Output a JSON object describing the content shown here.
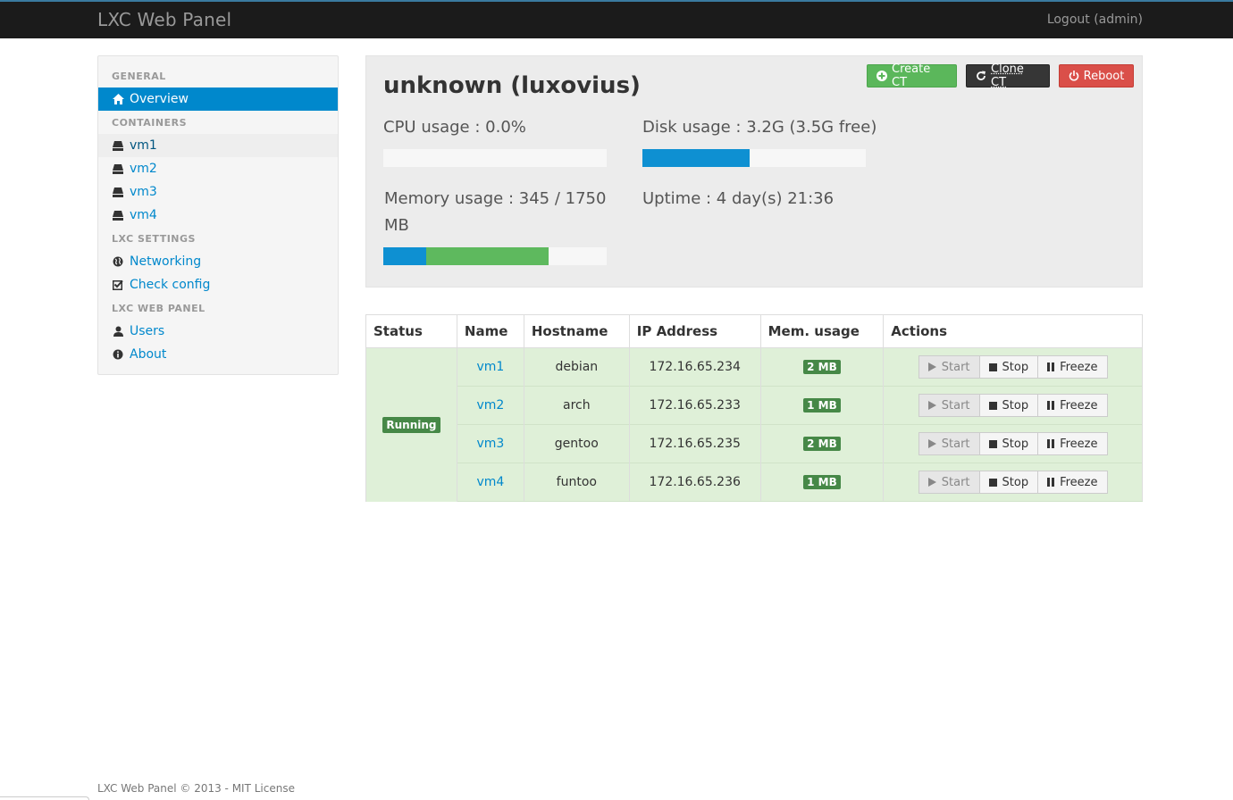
{
  "navbar": {
    "brand": "LXC Web Panel",
    "logout": "Logout (admin)"
  },
  "sidebar": {
    "headers": [
      "GENERAL",
      "CONTAINERS",
      "LXC SETTINGS",
      "LXC WEB PANEL"
    ],
    "overview": "Overview",
    "containers": [
      "vm1",
      "vm2",
      "vm3",
      "vm4"
    ],
    "settings": [
      "Networking",
      "Check config"
    ],
    "panel": [
      "Users",
      "About"
    ]
  },
  "host": {
    "title": "unknown (luxovius)",
    "cpu_label": "CPU usage : 0.0%",
    "disk_label": "Disk usage : 3.2G (3.5G free)",
    "memory_label": "Memory usage : 345 / 1750 MB",
    "uptime_label": "Uptime : 4 day(s) 21:36",
    "cpu_fraction": 0.0,
    "disk_fraction": 0.48,
    "memory_used_fraction": 0.19,
    "memory_cached_fraction": 0.55
  },
  "toolbar": {
    "create": "Create CT",
    "clone": "Clone CT",
    "reboot": "Reboot"
  },
  "table": {
    "headers": [
      "Status",
      "Name",
      "Hostname",
      "IP Address",
      "Mem. usage",
      "Actions"
    ],
    "status": "Running",
    "rows": [
      {
        "name": "vm1",
        "hostname": "debian",
        "ip": "172.16.65.234",
        "mem": "2 MB"
      },
      {
        "name": "vm2",
        "hostname": "arch",
        "ip": "172.16.65.233",
        "mem": "1 MB"
      },
      {
        "name": "vm3",
        "hostname": "gentoo",
        "ip": "172.16.65.235",
        "mem": "2 MB"
      },
      {
        "name": "vm4",
        "hostname": "funtoo",
        "ip": "172.16.65.236",
        "mem": "1 MB"
      }
    ],
    "actions": {
      "start": "Start",
      "stop": "Stop",
      "freeze": "Freeze"
    }
  },
  "footer": "LXC Web Panel © 2013 - MIT License",
  "colors": {
    "accent": "#0088cc",
    "success": "#5bb75b",
    "danger": "#da4f49",
    "row_success": "#dff0d8",
    "badge": "#468847"
  }
}
